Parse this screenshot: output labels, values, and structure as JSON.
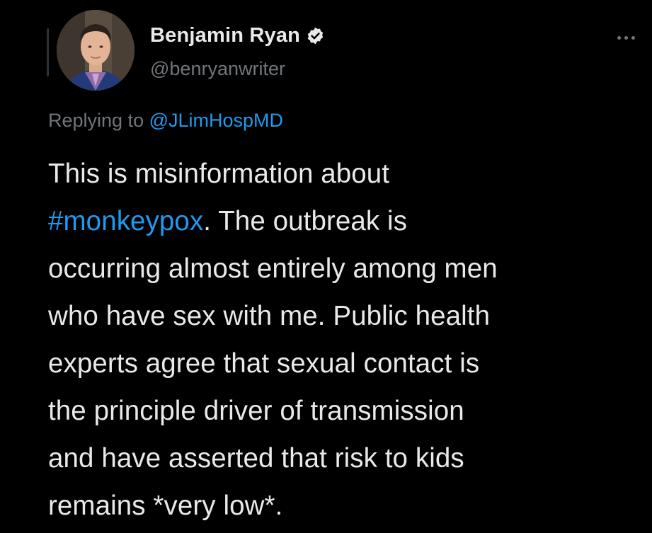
{
  "tweet": {
    "author": {
      "display_name": "Benjamin Ryan",
      "handle": "@benryanwriter",
      "verified_icon": "verified-badge-icon"
    },
    "more_icon": "more-horizontal-icon",
    "reply": {
      "prefix": "Replying to ",
      "mention": "@JLimHospMD"
    },
    "body": {
      "line1": "This is misinformation about",
      "hashtag": "#monkeypox",
      "line2_rest": ". The outbreak is",
      "line3": "occurring almost entirely among men",
      "line4": "who have sex with me. Public health",
      "line5": "experts agree that sexual contact is",
      "line6": "the principle driver of transmission",
      "line7": "and have asserted that risk to kids",
      "line8": "remains *very low*."
    }
  },
  "colors": {
    "background": "#000000",
    "text": "#e7e9ea",
    "muted": "#71767b",
    "accent": "#1d9bf0"
  }
}
